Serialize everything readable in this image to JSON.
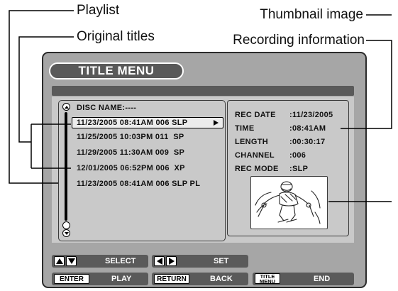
{
  "callouts": {
    "playlist": "Playlist",
    "original_titles": "Original titles",
    "thumbnail_image": "Thumbnail image",
    "recording_information": "Recording information"
  },
  "menu": {
    "title": "TITLE MENU",
    "disc_name_label": "DISC NAME:",
    "disc_name_value": "----"
  },
  "titles": [
    {
      "text": "11/23/2005 08:41AM 006 SLP",
      "selected": true
    },
    {
      "text": "11/25/2005 10:03PM 011  SP",
      "selected": false
    },
    {
      "text": "11/29/2005 11:30AM 009  SP",
      "selected": false
    },
    {
      "text": "12/01/2005 06:52PM 006  XP",
      "selected": false
    },
    {
      "text": "11/23/2005 08:41AM 006 SLP PL",
      "selected": false
    }
  ],
  "info": [
    {
      "label": "REC DATE",
      "value": ":11/23/2005"
    },
    {
      "label": "TIME",
      "value": ":08:41AM"
    },
    {
      "label": "LENGTH",
      "value": ":00:30:17"
    },
    {
      "label": "CHANNEL",
      "value": ":006"
    },
    {
      "label": "REC MODE",
      "value": ":SLP"
    }
  ],
  "controls": {
    "select": "SELECT",
    "set": "SET",
    "enter_key": "ENTER",
    "play": "PLAY",
    "return_key": "RETURN",
    "back": "BACK",
    "title_menu_key_line1": "TITLE",
    "title_menu_key_line2": "MENU",
    "end": "END"
  },
  "icons": {
    "scroll_up": "circle-up-arrow-icon",
    "scroll_down": "circle-down-arrow-icon",
    "selected_row": "play-triangle-icon",
    "thumbnail": "skier-illustration"
  },
  "colors": {
    "frame": "#a6a6a6",
    "panel": "#c9c9c9",
    "bars": "#5a5a5a",
    "text_light": "#ffffff"
  }
}
